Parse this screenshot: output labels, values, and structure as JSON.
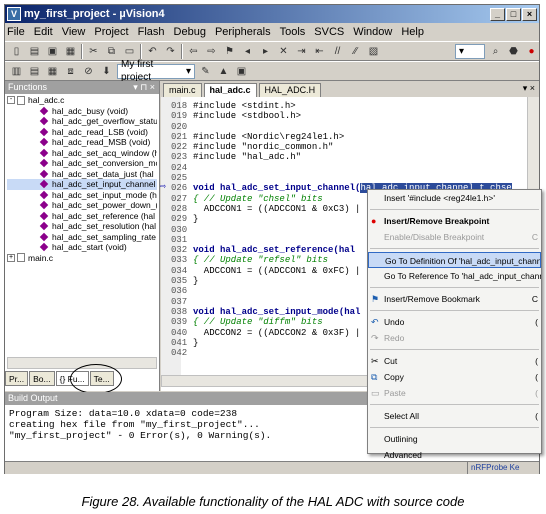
{
  "window": {
    "title": "my_first_project - µVision4"
  },
  "menu": [
    "File",
    "Edit",
    "View",
    "Project",
    "Flash",
    "Debug",
    "Peripherals",
    "Tools",
    "SVCS",
    "Window",
    "Help"
  ],
  "toolbar": {
    "target_combo": "My first project"
  },
  "functions_panel": {
    "title": "Functions",
    "root_file": "hal_adc.c",
    "functions": [
      "hal_adc_busy (void)",
      "hal_adc_get_overflow_statu",
      "hal_adc_read_LSB (void)",
      "hal_adc_read_MSB (void)",
      "hal_adc_set_acq_window (h",
      "hal_adc_set_conversion_mc",
      "hal_adc_set_data_just (hal",
      "hal_adc_set_input_channel",
      "hal_adc_set_input_mode (h",
      "hal_adc_set_power_down_(",
      "hal_adc_set_reference (hal",
      "hal_adc_set_resolution (hal",
      "hal_adc_set_sampling_rate",
      "hal_adc_start (void)"
    ],
    "selected_index": 7,
    "second_file": "main.c",
    "tabs": [
      "Pr...",
      "Bo...",
      "{} Fu...",
      "Te..."
    ]
  },
  "editor": {
    "tabs": [
      "main.c",
      "hal_adc.c",
      "HAL_ADC.H"
    ],
    "active_tab": 1,
    "lines": [
      {
        "n": "018",
        "t": "#include <stdint.h>"
      },
      {
        "n": "019",
        "t": "#include <stdbool.h>"
      },
      {
        "n": "020",
        "t": ""
      },
      {
        "n": "021",
        "t": "#include <Nordic\\reg24le1.h>"
      },
      {
        "n": "022",
        "t": "#include \"nordic_common.h\""
      },
      {
        "n": "023",
        "t": "#include \"hal_adc.h\""
      },
      {
        "n": "024",
        "t": ""
      },
      {
        "n": "025",
        "t": ""
      },
      {
        "n": "026",
        "t": "void hal_adc_set_input_channel(",
        "hl": "hal_adc_input_channel_t chse"
      },
      {
        "n": "027",
        "t": "{ // Update \"chsel\" bits"
      },
      {
        "n": "028",
        "t": "  ADCCON1 = ((ADCCON1 & 0xC3) |"
      },
      {
        "n": "029",
        "t": "}"
      },
      {
        "n": "030",
        "t": ""
      },
      {
        "n": "031",
        "t": ""
      },
      {
        "n": "032",
        "t": "void hal_adc_set_reference(hal"
      },
      {
        "n": "033",
        "t": "{ // Update \"refsel\" bits"
      },
      {
        "n": "034",
        "t": "  ADCCON1 = ((ADCCON1 & 0xFC) |"
      },
      {
        "n": "035",
        "t": "}"
      },
      {
        "n": "036",
        "t": ""
      },
      {
        "n": "037",
        "t": ""
      },
      {
        "n": "038",
        "t": "void hal_adc_set_input_mode(hal"
      },
      {
        "n": "039",
        "t": "{ // Update \"diffm\" bits"
      },
      {
        "n": "040",
        "t": "  ADCCON2 = ((ADCCON2 & 0x3F) |"
      },
      {
        "n": "041",
        "t": "}"
      },
      {
        "n": "042",
        "t": ""
      }
    ]
  },
  "build_output": {
    "title": "Build Output",
    "lines": [
      "Program Size: data=10.0 xdata=0 code=238",
      "creating hex file from \"my_first_project\"...",
      "\"my_first_project\" - 0 Error(s), 0 Warning(s)."
    ]
  },
  "status_bar": {
    "right": "nRFProbe Ke"
  },
  "context_menu": [
    {
      "label": "Insert '#include <reg24le1.h>'"
    },
    {
      "sep": true
    },
    {
      "label": "Insert/Remove Breakpoint",
      "bold": true,
      "icon": "breakpoint-icon"
    },
    {
      "label": "Enable/Disable Breakpoint",
      "disabled": true,
      "sc": "C"
    },
    {
      "sep": true
    },
    {
      "label": "Go To Definition Of 'hal_adc_input_channe",
      "hover": true
    },
    {
      "label": "Go To Reference To 'hal_adc_input_channe"
    },
    {
      "sep": true
    },
    {
      "label": "Insert/Remove Bookmark",
      "icon": "bookmark-icon",
      "sc": "C"
    },
    {
      "sep": true
    },
    {
      "label": "Undo",
      "icon": "undo-icon",
      "sc": "("
    },
    {
      "label": "Redo",
      "disabled": true,
      "icon": "redo-icon"
    },
    {
      "sep": true
    },
    {
      "label": "Cut",
      "icon": "cut-icon",
      "sc": "("
    },
    {
      "label": "Copy",
      "icon": "copy-icon",
      "sc": "("
    },
    {
      "label": "Paste",
      "disabled": true,
      "icon": "paste-icon",
      "sc": "("
    },
    {
      "sep": true
    },
    {
      "label": "Select All",
      "sc": "("
    },
    {
      "sep": true
    },
    {
      "label": "Outlining"
    },
    {
      "label": "Advanced"
    }
  ],
  "caption": "Figure 28. Available functionality of the HAL ADC with source code"
}
